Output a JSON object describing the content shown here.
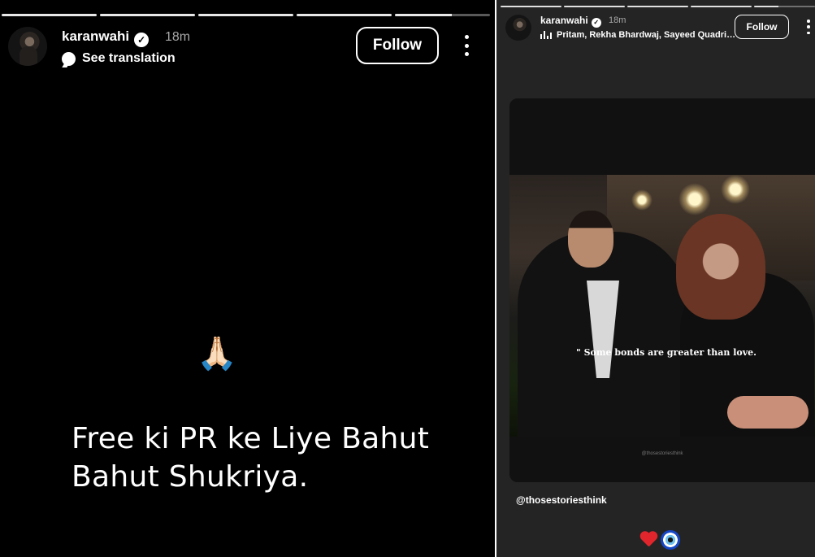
{
  "left_story": {
    "progress_segments": [
      1,
      1,
      1,
      1,
      0.6
    ],
    "username": "karanwahi",
    "time": "18m",
    "translate_label": "See translation",
    "follow_label": "Follow",
    "emoji": "🙏🏻",
    "caption": "Free ki PR ke Liye Bahut Bahut Shukriya."
  },
  "right_story": {
    "progress_segments": [
      1,
      1,
      1,
      1,
      0.4
    ],
    "username": "karanwahi",
    "time": "18m",
    "music": "Pritam, Rekha Bhardwaj, Sayeed Quadri…",
    "follow_label": "Follow",
    "quote": "\" Some bonds are greater than love.",
    "watermark": "@thosestoriesthink",
    "mention": "@thosestoriesthink"
  },
  "colors": {
    "left_background": "#000000",
    "right_background": "#242424",
    "heart": "#e0252d",
    "nazar_blue": "#1546c6"
  },
  "icons": [
    "verified-icon",
    "translate-icon",
    "more-icon",
    "music-icon",
    "heart-emoji",
    "nazar-emoji"
  ]
}
